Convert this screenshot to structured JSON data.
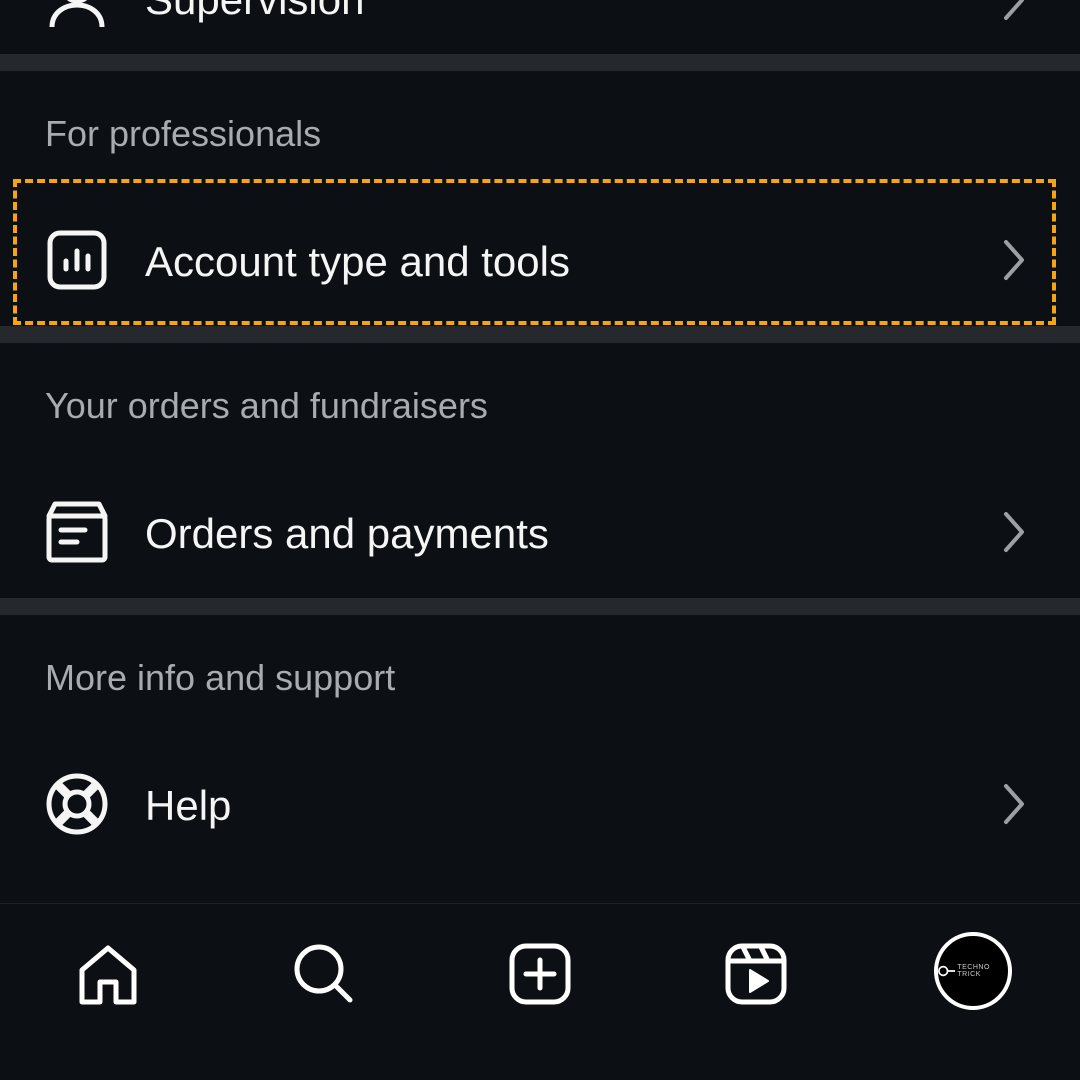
{
  "top_item": {
    "label": "Supervision"
  },
  "sections": {
    "professionals": {
      "header": "For professionals",
      "item": {
        "label": "Account type and tools",
        "icon": "chart-box-icon"
      }
    },
    "orders": {
      "header": "Your orders and fundraisers",
      "item": {
        "label": "Orders and payments",
        "icon": "receipt-box-icon"
      }
    },
    "support": {
      "header": "More info and support",
      "item": {
        "label": "Help",
        "icon": "lifebuoy-icon"
      }
    }
  },
  "bottom_nav": {
    "items": [
      "home-icon",
      "search-icon",
      "create-icon",
      "reels-icon",
      "profile-avatar"
    ],
    "avatar_text": "TECHNO TRICK"
  },
  "colors": {
    "background": "#0c1014",
    "divider": "#25292e",
    "highlight": "#f4a50f",
    "header_text": "#a8abb0",
    "text": "#f5f5f5"
  }
}
